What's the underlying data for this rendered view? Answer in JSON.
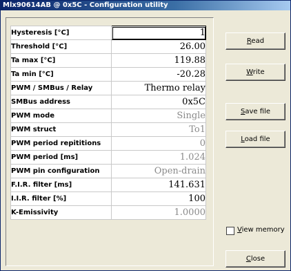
{
  "window": {
    "title": "Mlx90614AB @ 0x5C - Configuration utility"
  },
  "rows": [
    {
      "label": "Hysteresis [°C]",
      "value": "1",
      "dim": false,
      "editing": true
    },
    {
      "label": "Threshold [°C]",
      "value": "26.00",
      "dim": false
    },
    {
      "label": "Ta max [°C]",
      "value": "119.88",
      "dim": false
    },
    {
      "label": "Ta min [°C]",
      "value": "-20.28",
      "dim": false
    },
    {
      "label": "PWM / SMBus / Relay",
      "value": "Thermo relay",
      "dim": false
    },
    {
      "label": "SMBus address",
      "value": "0x5C",
      "dim": false
    },
    {
      "label": "PWM mode",
      "value": "Single",
      "dim": true
    },
    {
      "label": "PWM struct",
      "value": "To1",
      "dim": true
    },
    {
      "label": "PWM period repititions",
      "value": "0",
      "dim": true
    },
    {
      "label": "PWM period [ms]",
      "value": "1.024",
      "dim": true
    },
    {
      "label": "PWM pin configuration",
      "value": "Open-drain",
      "dim": true
    },
    {
      "label": "F.I.R. filter [ms]",
      "value": "141.631",
      "dim": false
    },
    {
      "label": "I.I.R. filter [%]",
      "value": "100",
      "dim": false
    },
    {
      "label": "K-Emissivity",
      "value": "1.0000",
      "dim": true
    }
  ],
  "buttons": {
    "read": {
      "key": "R",
      "rest": "ead"
    },
    "write": {
      "key": "W",
      "rest": "rite"
    },
    "save": {
      "key": "S",
      "rest": "ave file"
    },
    "load": {
      "key": "L",
      "rest": "oad file"
    },
    "close": {
      "key": "C",
      "rest": "lose"
    }
  },
  "view_memory": {
    "key": "V",
    "rest": "iew memory",
    "checked": false
  }
}
